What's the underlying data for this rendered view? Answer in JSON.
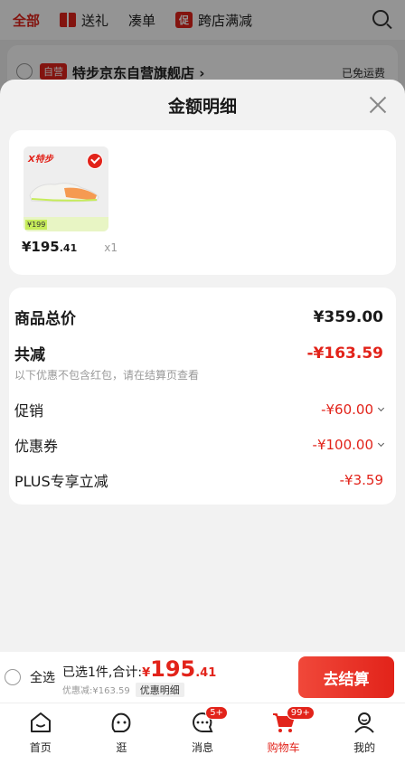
{
  "background": {
    "tabs": [
      "全部",
      "送礼",
      "凑单",
      "跨店满减"
    ],
    "promo_tag": "促",
    "store_badge": "自营",
    "store_name": "特步京东自营旗舰店 ›",
    "free_shipping": "已免运费"
  },
  "modal": {
    "title": "金额明细",
    "product": {
      "brand": "X特步",
      "image_price": "¥199",
      "price_int": "¥195",
      "price_dec": ".41",
      "quantity": "x1"
    },
    "breakdown": {
      "total_label": "商品总价",
      "total_value": "¥359.00",
      "discount_label": "共减",
      "discount_value": "-¥163.59",
      "note": "以下优惠不包含红包，请在结算页查看",
      "promo_label": "促销",
      "promo_value": "-¥60.00",
      "coupon_label": "优惠券",
      "coupon_value": "-¥100.00",
      "plus_label": "PLUS专享立减",
      "plus_value": "-¥3.59"
    }
  },
  "checkout": {
    "select_all": "全选",
    "summary": "已选1件,合计:",
    "yen": "¥",
    "total_int": "195",
    "total_dec": ".41",
    "discount_text": "优惠减:¥163.59",
    "detail_label": "优惠明细",
    "pay_button": "去结算"
  },
  "tabbar": {
    "items": [
      {
        "label": "首页"
      },
      {
        "label": "逛"
      },
      {
        "label": "消息",
        "badge": "5+"
      },
      {
        "label": "购物车",
        "badge": "99+"
      },
      {
        "label": "我的"
      }
    ]
  },
  "colors": {
    "accent": "#e2231a"
  }
}
